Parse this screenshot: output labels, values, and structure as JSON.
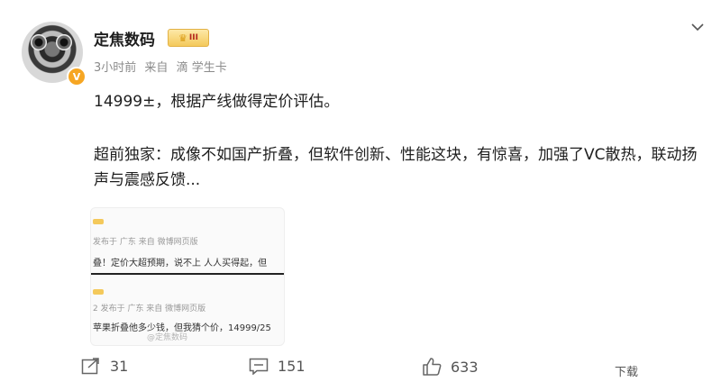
{
  "post": {
    "username": "定焦数码",
    "rank_badge": "III",
    "verified_badge": "V",
    "meta": {
      "time": "3小时前",
      "source_prefix": "来自",
      "source": "滴 学生卡"
    },
    "content": {
      "line1": "14999±，根据产线做得定价评估。",
      "line2": "超前独家：成像不如国产折叠，但软件创新、性能这块，有惊喜，加强了VC散热，联动扬声与震感反馈..."
    },
    "thumbnail": {
      "block1_meta": "发布于 广东  来自  微博网页版",
      "block1_text": "叠！定价大超预期，说不上 人人买得起，但",
      "block2_meta": "2 发布于 广东  来自 微博网页版",
      "block2_text": "苹果折叠他多少钱，但我猜个价，14999/25",
      "watermark": "@定焦数码"
    },
    "actions": {
      "share_count": "31",
      "comment_count": "151",
      "like_count": "633",
      "download_label": "下载"
    }
  }
}
